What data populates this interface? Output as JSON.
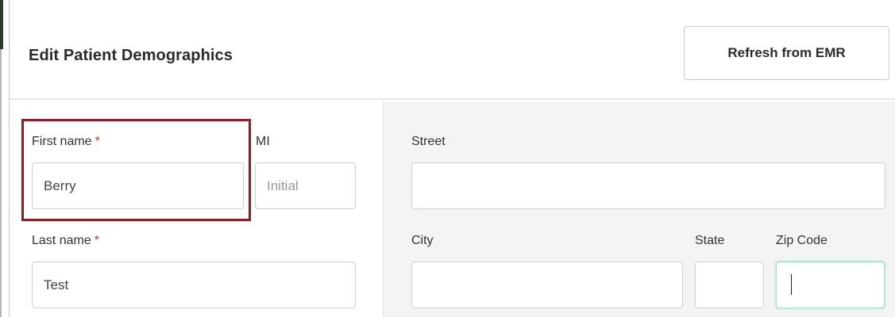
{
  "header": {
    "title": "Edit Patient Demographics",
    "refresh_label": "Refresh from EMR"
  },
  "form": {
    "required_mark": "*",
    "first_name": {
      "label": "First name",
      "value": "Berry"
    },
    "mi": {
      "label": "MI",
      "placeholder": "Initial",
      "value": ""
    },
    "last_name": {
      "label": "Last name",
      "value": "Test"
    },
    "street": {
      "label": "Street",
      "value": ""
    },
    "city": {
      "label": "City",
      "value": ""
    },
    "state": {
      "label": "State",
      "value": ""
    },
    "zip": {
      "label": "Zip Code",
      "value": ""
    }
  },
  "colors": {
    "highlight": "#8b1f24",
    "required": "#c0392b",
    "focus": "#a8dcc4"
  }
}
